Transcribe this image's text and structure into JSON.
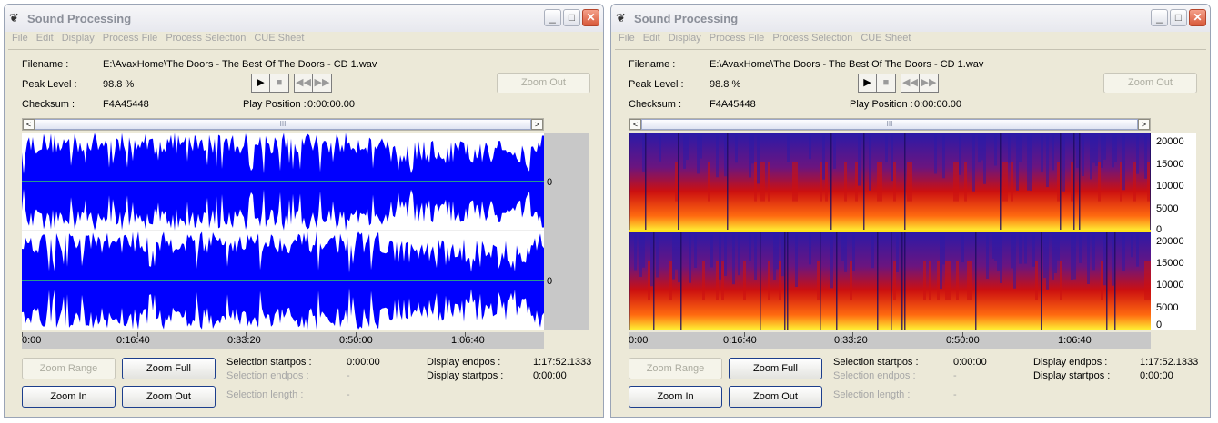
{
  "app": {
    "title": "Sound Processing",
    "icon": "bug-icon",
    "menu": [
      "File",
      "Edit",
      "Display",
      "Process File",
      "Process Selection",
      "CUE Sheet"
    ],
    "window_buttons": {
      "minimize": "_",
      "maximize": "□",
      "close": "✕"
    }
  },
  "info": {
    "filename_label": "Filename :",
    "filename_value": "E:\\AvaxHome\\The Doors - The Best Of The Doors - CD 1.wav",
    "peak_label": "Peak Level :",
    "peak_value": "98.8 %",
    "checksum_label": "Checksum :",
    "checksum_value": "F4A45448",
    "play_position_label": "Play Position :",
    "play_position_value": "0:00:00.00"
  },
  "transport": {
    "play": "▶",
    "stop": "■",
    "rewind": "◀◀",
    "forward": "▶▶"
  },
  "buttons": {
    "zoom_out_top": "Zoom Out",
    "zoom_range": "Zoom Range",
    "zoom_full": "Zoom Full",
    "zoom_in": "Zoom In",
    "zoom_out": "Zoom Out"
  },
  "scroll": {
    "left": "<",
    "right": ">",
    "thumb": "III"
  },
  "selection": {
    "startpos_label": "Selection startpos :",
    "startpos_value": "0:00:00",
    "endpos_label": "Selection endpos :",
    "endpos_value": "-",
    "length_label": "Selection length :",
    "length_value": "-"
  },
  "display": {
    "endpos_label": "Display endpos :",
    "endpos_value": "1:17:52.1333",
    "startpos_label": "Display startpos :",
    "startpos_value": "0:00:00"
  },
  "timeline": [
    "0:00",
    "0:16:40",
    "0:33:20",
    "0:50:00",
    "1:06:40"
  ],
  "waveform": {
    "zero_labels": [
      "0",
      "0"
    ],
    "colors": {
      "fill": "#0000ff",
      "axis": "#33cc66",
      "gaps": "#ffffff"
    }
  },
  "spectrogram": {
    "freq_labels": [
      "20000",
      "15000",
      "10000",
      "5000",
      "0"
    ],
    "colors": {
      "high": "#2a1aa8",
      "mid": "#cc1010",
      "low": "#ffee33"
    }
  }
}
